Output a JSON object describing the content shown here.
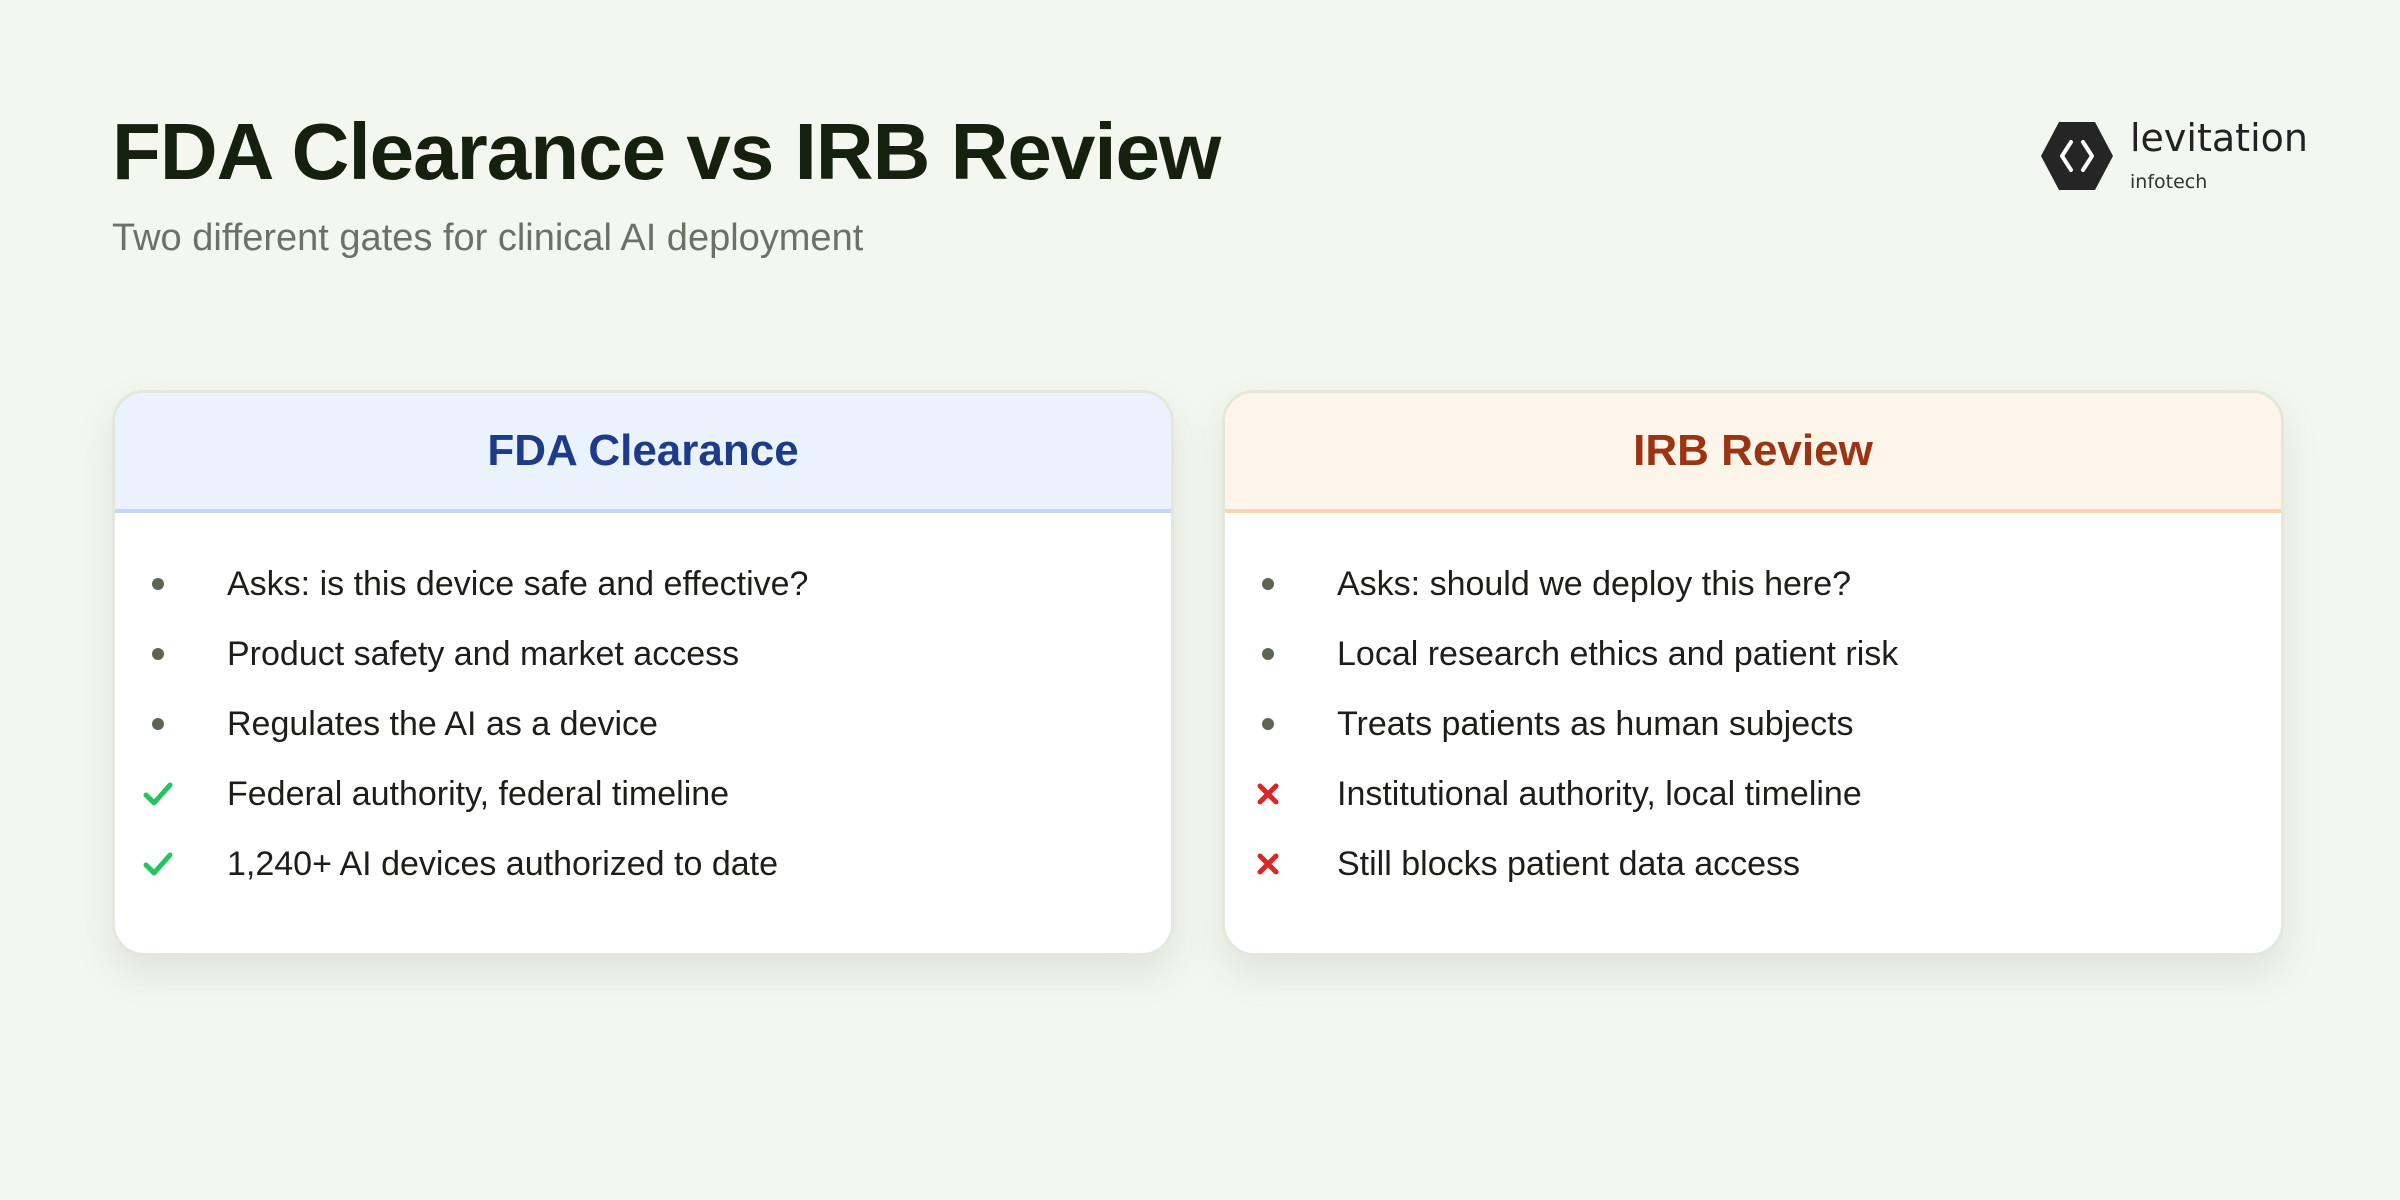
{
  "header": {
    "title": "FDA Clearance vs IRB Review",
    "subtitle": "Two different gates for clinical AI deployment"
  },
  "logo": {
    "icon": "hexagon-chevrons-icon",
    "name": "levitation",
    "sub": "infotech"
  },
  "colors": {
    "background": "#f4f7f0",
    "fda_accent": "#1e3a8a",
    "fda_header_bg": "#eaf2fc",
    "irb_accent": "#9a3412",
    "irb_header_bg": "#fdf4ea",
    "check": "#22c55e",
    "cross": "#dc2626",
    "bullet": "#5d6653"
  },
  "cards": [
    {
      "title": "FDA Clearance",
      "items": [
        {
          "marker": "bullet",
          "text": "Asks: is this device safe and effective?"
        },
        {
          "marker": "bullet",
          "text": "Product safety and market access"
        },
        {
          "marker": "bullet",
          "text": "Regulates the AI as a device"
        },
        {
          "marker": "check",
          "text": "Federal authority, federal timeline"
        },
        {
          "marker": "check",
          "text": "1,240+ AI devices authorized to date"
        }
      ]
    },
    {
      "title": "IRB Review",
      "items": [
        {
          "marker": "bullet",
          "text": "Asks: should we deploy this here?"
        },
        {
          "marker": "bullet",
          "text": "Local research ethics and patient risk"
        },
        {
          "marker": "bullet",
          "text": "Treats patients as human subjects"
        },
        {
          "marker": "cross",
          "text": "Institutional authority, local timeline"
        },
        {
          "marker": "cross",
          "text": "Still blocks patient data access"
        }
      ]
    }
  ]
}
